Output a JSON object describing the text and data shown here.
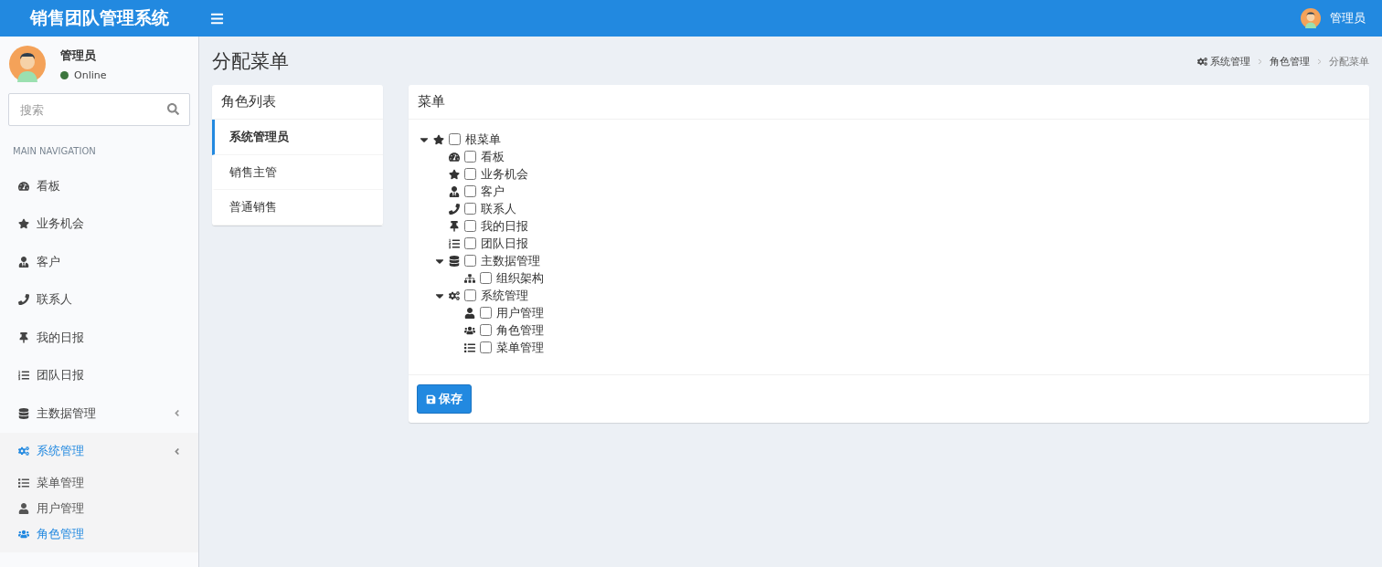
{
  "header": {
    "title": "销售团队管理系统",
    "user": "管理员"
  },
  "sidebar": {
    "user": {
      "name": "管理员",
      "status": "Online"
    },
    "search": {
      "placeholder": "搜索"
    },
    "section": "MAIN NAVIGATION",
    "items": [
      {
        "label": "看板",
        "selected": false
      },
      {
        "label": "业务机会",
        "selected": false
      },
      {
        "label": "客户",
        "selected": false
      },
      {
        "label": "联系人",
        "selected": false
      },
      {
        "label": "我的日报",
        "selected": false
      },
      {
        "label": "团队日报",
        "selected": false
      },
      {
        "label": "主数据管理",
        "selected": false,
        "expanded": false
      },
      {
        "label": "系统管理",
        "selected": true,
        "expanded": true,
        "children": [
          {
            "label": "菜单管理",
            "selected": false
          },
          {
            "label": "用户管理",
            "selected": false
          },
          {
            "label": "角色管理",
            "selected": true
          }
        ]
      }
    ]
  },
  "page": {
    "title": "分配菜单",
    "breadcrumb": [
      "系统管理",
      "角色管理",
      "分配菜单"
    ]
  },
  "roles": {
    "title": "角色列表",
    "items": [
      {
        "label": "系统管理员",
        "selected": true
      },
      {
        "label": "销售主管",
        "selected": false
      },
      {
        "label": "普通销售",
        "selected": false
      }
    ]
  },
  "menu": {
    "title": "菜单",
    "save": "保存",
    "tree": [
      {
        "label": "根菜单",
        "checked": false,
        "expanded": true,
        "children": [
          {
            "label": "看板",
            "checked": false
          },
          {
            "label": "业务机会",
            "checked": false
          },
          {
            "label": "客户",
            "checked": false
          },
          {
            "label": "联系人",
            "checked": false
          },
          {
            "label": "我的日报",
            "checked": false
          },
          {
            "label": "团队日报",
            "checked": false
          },
          {
            "label": "主数据管理",
            "checked": false,
            "expanded": true,
            "children": [
              {
                "label": "组织架构",
                "checked": false
              }
            ]
          },
          {
            "label": "系统管理",
            "checked": false,
            "expanded": true,
            "children": [
              {
                "label": "用户管理",
                "checked": false
              },
              {
                "label": "角色管理",
                "checked": false
              },
              {
                "label": "菜单管理",
                "checked": false
              }
            ]
          }
        ]
      }
    ]
  }
}
